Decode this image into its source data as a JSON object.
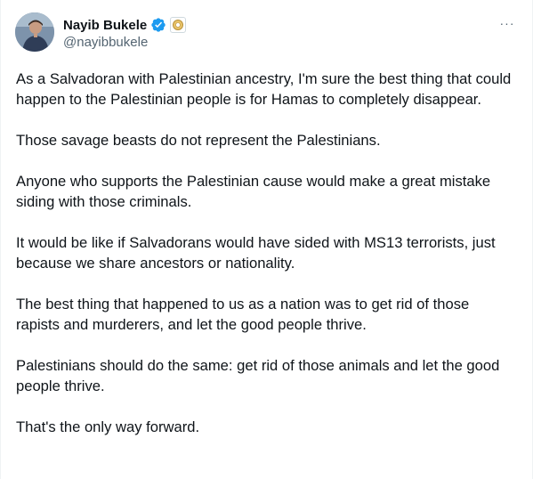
{
  "author": {
    "display_name": "Nayib Bukele",
    "handle": "@nayibbukele",
    "avatar_icon": "profile-photo",
    "verified_icon": "verified-badge-icon",
    "affiliation_icon": "affiliation-badge-icon"
  },
  "menu": {
    "more_icon": "more-options-icon",
    "more_glyph": "···"
  },
  "tweet": {
    "paragraphs": [
      "As a Salvadoran with Palestinian ancestry, I'm sure the best thing that could happen to the Palestinian people is for Hamas to completely disappear.",
      "Those savage beasts do not represent the Palestinians.",
      "Anyone who supports the Palestinian cause would make a great mistake siding with those criminals.",
      "It would be like if Salvadorans would have sided with MS13 terrorists, just because we share ancestors or nationality.",
      "The best thing that happened to us as a nation was to get rid of those rapists and murderers, and let the good people thrive.",
      "Palestinians should do the same: get rid of those animals and let the good people thrive.",
      "That's the only way forward."
    ]
  },
  "colors": {
    "text": "#0f1419",
    "secondary": "#536471",
    "verified_blue": "#1d9bf0",
    "border": "#eff3f4"
  }
}
